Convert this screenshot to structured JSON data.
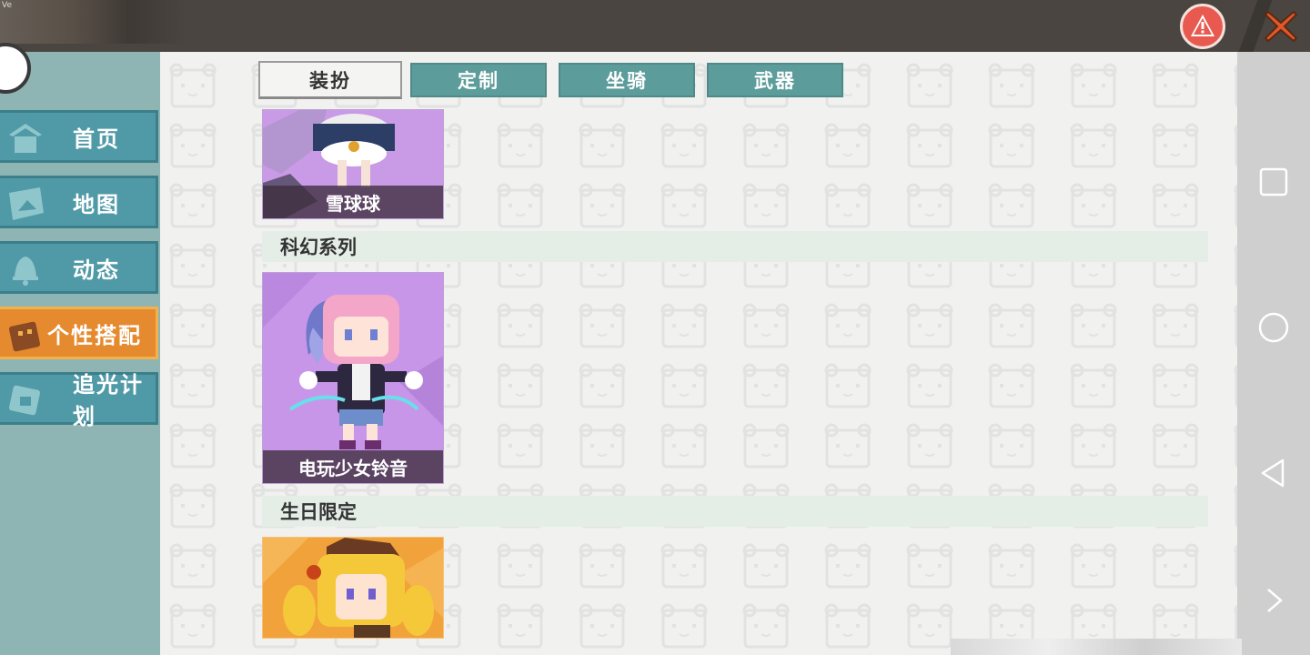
{
  "top_bar": {
    "version_text": "Ve"
  },
  "sidebar": {
    "items": [
      {
        "label": "首页",
        "icon": "home-icon",
        "active": false
      },
      {
        "label": "地图",
        "icon": "map-icon",
        "active": false
      },
      {
        "label": "动态",
        "icon": "bell-icon",
        "active": false
      },
      {
        "label": "个性搭配",
        "icon": "outfit-icon",
        "active": true
      },
      {
        "label": "追光计划",
        "icon": "plan-icon",
        "active": false
      }
    ]
  },
  "tabs": [
    {
      "label": "装扮",
      "active": true
    },
    {
      "label": "定制",
      "active": false
    },
    {
      "label": "坐骑",
      "active": false
    },
    {
      "label": "武器",
      "active": false
    }
  ],
  "content": {
    "card_snowball": {
      "label": "雪球球"
    },
    "section_scifi": {
      "title": "科幻系列"
    },
    "card_gamer_girl": {
      "label": "电玩少女铃音"
    },
    "section_birthday": {
      "title": "生日限定"
    }
  },
  "colors": {
    "nav_bg": "#4f9aa6",
    "nav_active": "#e58a2e",
    "tab_bg": "#5c9c9a",
    "alert": "#e85a50",
    "close": "#e0582a"
  }
}
